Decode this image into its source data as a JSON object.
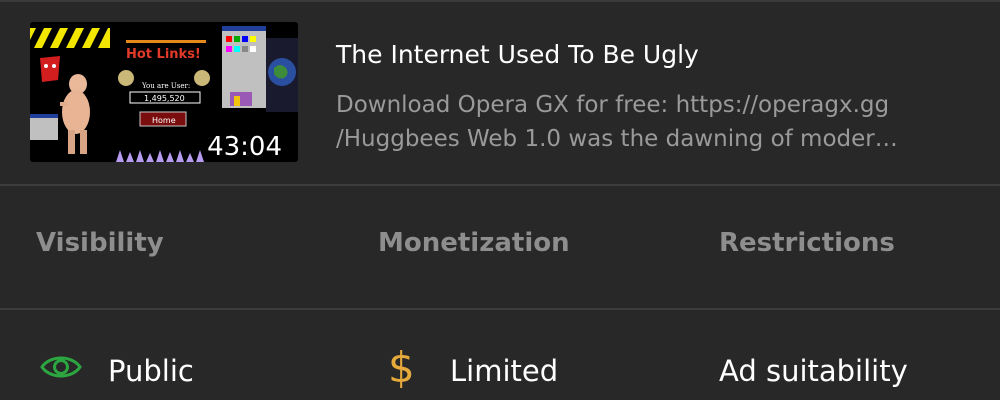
{
  "video": {
    "title": "The Internet Used To Be Ugly",
    "description_line1": "Download Opera GX for free: https://operagx.gg",
    "description_line2": "/Huggbees Web 1.0 was the dawning of moder…",
    "duration": "43:04",
    "thumbnail": {
      "banner_text": "Hot Links!",
      "counter_label": "You are User:",
      "counter_value": "1,495,520",
      "home_button": "Home"
    }
  },
  "columns": {
    "visibility_header": "Visibility",
    "monetization_header": "Monetization",
    "restrictions_header": "Restrictions"
  },
  "values": {
    "visibility": "Public",
    "monetization": "Limited",
    "restrictions": "Ad suitability"
  },
  "icons": {
    "visibility_icon": "eye-icon",
    "monetization_icon": "dollar-icon"
  },
  "colors": {
    "background": "#282828",
    "eye_icon": "#2ba640",
    "dollar_icon": "#e6a93b",
    "header_text": "#8e8e8e",
    "desc_text": "#9a9a9a"
  }
}
